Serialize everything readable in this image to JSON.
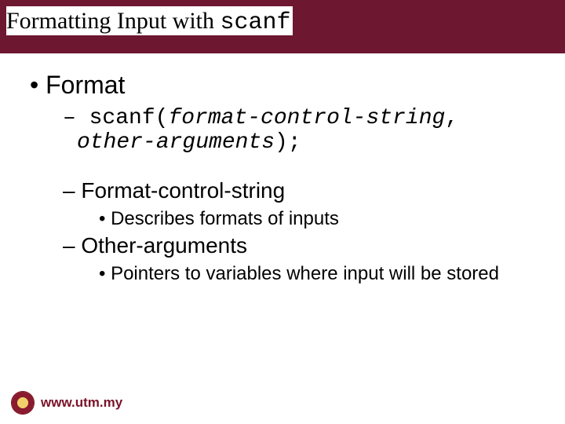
{
  "header": {
    "title_prefix": "Formatting Input with ",
    "title_code": "scanf"
  },
  "content": {
    "format_heading": "Format",
    "syntax_prefix": "scanf(",
    "syntax_arg1": "format-control-string",
    "syntax_sep": ", ",
    "syntax_arg2": "other-arguments",
    "syntax_suffix": ");",
    "sub1_heading": "Format-control-string",
    "sub1_desc": "Describes formats of inputs",
    "sub2_heading": "Other-arguments",
    "sub2_desc": "Pointers to variables where input will be stored"
  },
  "footer": {
    "url": "www.utm.my",
    "logo_name": "utm-logo"
  }
}
